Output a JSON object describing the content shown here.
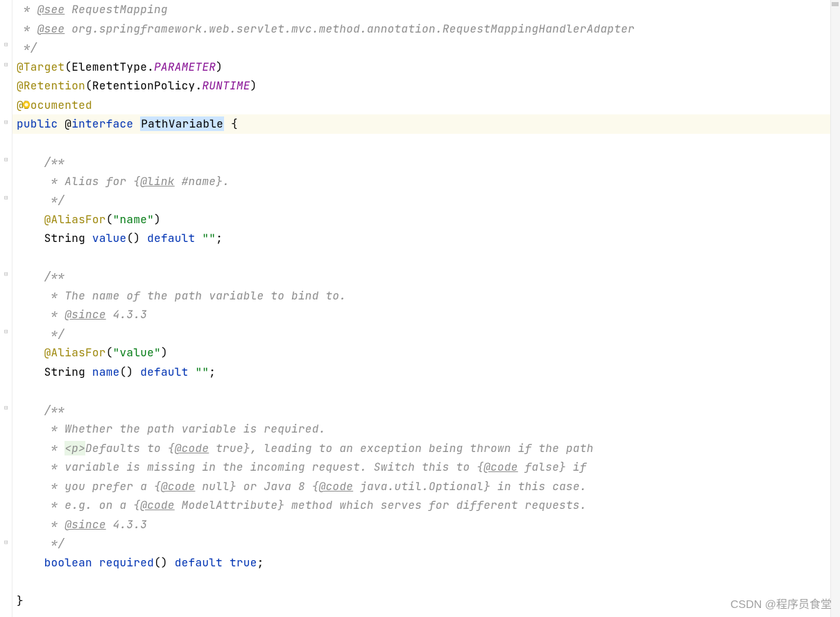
{
  "code": {
    "l1_pre": " * ",
    "l1_tag": "@see",
    "l1_txt": " RequestMapping",
    "l2_pre": " * ",
    "l2_tag": "@see",
    "l2_txt": " org.springframework.web.servlet.mvc.method.annotation.RequestMappingHandlerAdapter",
    "l3": " */",
    "l4_ann": "@Target",
    "l4_paren1": "(",
    "l4_cls": "ElementType",
    "l4_dot": ".",
    "l4_mem": "PARAMETER",
    "l4_paren2": ")",
    "l5_ann": "@Retention",
    "l5_paren1": "(",
    "l5_cls": "RetentionPolicy",
    "l5_dot": ".",
    "l5_mem": "RUNTIME",
    "l5_paren2": ")",
    "l6_ann": "@Documented",
    "l7_kw1": "public",
    "l7_at": " @",
    "l7_kw2": "interface",
    "l7_sp": " ",
    "l7_name": "PathVariable",
    "l7_brace": " {",
    "l8": "",
    "l9": "    /**",
    "l10_pre": "     * Alias for {",
    "l10_tag": "@link",
    "l10_post": " #name}.",
    "l11": "     */",
    "l12_ind": "    ",
    "l12_ann": "@AliasFor",
    "l12_p1": "(",
    "l12_str": "\"name\"",
    "l12_p2": ")",
    "l13_ind": "    ",
    "l13_type": "String",
    "l13_sp1": " ",
    "l13_name": "value",
    "l13_par": "()",
    "l13_sp2": " ",
    "l13_kw": "default",
    "l13_sp3": " ",
    "l13_str": "\"\"",
    "l13_sc": ";",
    "l14": "",
    "l15": "    /**",
    "l16": "     * The name of the path variable to bind to.",
    "l17_pre": "     * ",
    "l17_tag": "@since",
    "l17_post": " 4.3.3",
    "l18": "     */",
    "l19_ind": "    ",
    "l19_ann": "@AliasFor",
    "l19_p1": "(",
    "l19_str": "\"value\"",
    "l19_p2": ")",
    "l20_ind": "    ",
    "l20_type": "String",
    "l20_sp1": " ",
    "l20_name": "name",
    "l20_par": "()",
    "l20_sp2": " ",
    "l20_kw": "default",
    "l20_sp3": " ",
    "l20_str": "\"\"",
    "l20_sc": ";",
    "l21": "",
    "l22": "    /**",
    "l23": "     * Whether the path variable is required.",
    "l24_pre": "     * ",
    "l24_hl": "<p>",
    "l24_mid": "Defaults to {",
    "l24_tag": "@code",
    "l24_post": " true}, leading to an exception being thrown if the path",
    "l25_pre": "     * variable is missing in the incoming request. Switch this to {",
    "l25_tag": "@code",
    "l25_post": " false} if",
    "l26_pre": "     * you prefer a {",
    "l26_tag1": "@code",
    "l26_mid1": " null} or Java 8 {",
    "l26_tag2": "@code",
    "l26_post": " java.util.Optional} in this case.",
    "l27_pre": "     * e.g. on a {",
    "l27_tag": "@code",
    "l27_post": " ModelAttribute} method which serves for different requests.",
    "l28_pre": "     * ",
    "l28_tag": "@since",
    "l28_post": " 4.3.3",
    "l29": "     */",
    "l30_ind": "    ",
    "l30_kw1": "boolean",
    "l30_sp1": " ",
    "l30_name": "required",
    "l30_par": "()",
    "l30_sp2": " ",
    "l30_kw2": "default",
    "l30_sp3": " ",
    "l30_kw3": "true",
    "l30_sc": ";",
    "l31": "",
    "l32": "}"
  },
  "watermark": "CSDN @程序员食堂"
}
